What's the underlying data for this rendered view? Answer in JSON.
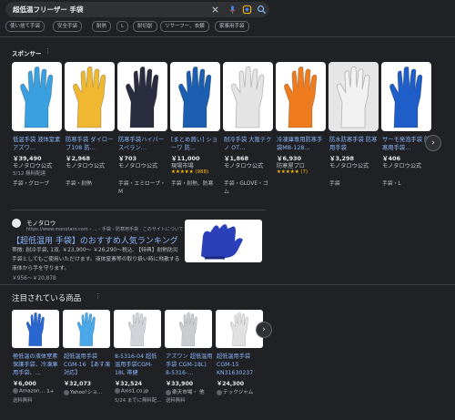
{
  "search": {
    "query": "超低温フリーザー 手袋",
    "icons": [
      "clear-icon",
      "mic-icon",
      "lens-icon",
      "search-icon"
    ]
  },
  "chips": [
    "使い捨て手袋",
    "安全手袋",
    "耐熱",
    "L",
    "耐切創",
    "リサーフー、衣類",
    "家事用手袋"
  ],
  "sponsored": {
    "label": "スポンサー",
    "products": [
      {
        "title": "低温手袋 液体窒素 アズワ…",
        "price": "￥39,490",
        "shop": "モノタロウ公式",
        "extra": "5/12 無料配達",
        "category": "手袋・グローブ",
        "glove": "#3aa0e0",
        "bg": "#ffffff"
      },
      {
        "title": "防寒手袋 ダイローブ108 防…",
        "price": "￥2,968",
        "shop": "モノタロウ公式",
        "extra": "",
        "category": "手袋・耐熱",
        "glove": "#f0b830",
        "bg": "#ffffff"
      },
      {
        "title": "防寒手袋ハイパースペラン…",
        "price": "￥703",
        "shop": "モノタロウ公式",
        "extra": "",
        "category": "手袋・エミロープ・M",
        "glove": "#2a2d40",
        "bg": "#ffffff"
      },
      {
        "title": "[まとめ買い] ショーワ 防…",
        "price": "￥11,000",
        "shop": "現場市場",
        "extra": "★★★★★ (988)",
        "category": "手袋・耐熱、防寒",
        "glove": "#1c5fb0",
        "bg": "#ffffff"
      },
      {
        "title": "耐冷手袋 大阪テクノ OT…",
        "price": "￥1,868",
        "shop": "モノタロウ公式",
        "extra": "",
        "category": "手袋・GLOVE・ゴム",
        "glove": "#e4e4e4",
        "bg": "#ffffff"
      },
      {
        "title": "冷凍庫専用防寒手袋MB-128…",
        "price": "￥6,930",
        "shop": "防寒屋プロ",
        "extra": "★★★★★ (7)",
        "category": "",
        "glove": "#ee7c1e",
        "bg": "#ffffff"
      },
      {
        "title": "防水防寒手袋 防寒用手袋",
        "price": "￥3,298",
        "shop": "モノタロウ公式",
        "extra": "",
        "category": "手袋",
        "glove": "#f2f2f2",
        "bg": "#e6e6e6"
      },
      {
        "title": "サーモ発泡手袋 防寒用手袋…",
        "price": "￥406",
        "shop": "モノタロウ公式",
        "extra": "",
        "category": "手袋・L",
        "glove": "#1f5ec8",
        "bg": "#ffffff"
      }
    ]
  },
  "result": {
    "site_name": "モノタロウ",
    "site_url": "https://www.monotaro.com › ... › 手袋 › 防寒用手袋 · このサイトについて",
    "title": "【超低温用 手袋】のおすすめ人気ランキング",
    "snippet": "帯徴: 耐冷手袋, 1双. ￥23,900〜 ￥26,290〜税込. 【特典】耐熱防災手袋としてもご使用いただけます。液体窒素等の取り扱い時に飛散する液体から手を守ります。",
    "price_range": "￥956〜￥20,878"
  },
  "popular": {
    "title": "注目されている商品",
    "products": [
      {
        "title": "極低温の液体窒素保護手袋、冷凍庫用手袋、…",
        "price": "￥6,000",
        "shop": "Amazon…",
        "shop_suffix": "1+",
        "ship": "送料無料",
        "glove": "#2a66d0"
      },
      {
        "title": "超低温用手袋CGM-16 【あす楽対応】",
        "price": "￥32,073",
        "shop": "Yahoo!ショ…",
        "shop_suffix": "",
        "ship": "",
        "glove": "#4aa8e8"
      },
      {
        "title": "8-5316-04 超低温用手袋CGM-18L 帯健",
        "price": "￥32,524",
        "shop": "Axis1.co.jp",
        "shop_suffix": "",
        "ship": "5/24 までに無料配…",
        "glove": "#d0d4d8"
      },
      {
        "title": "アズワン 超低温用手袋 CGM-18L) 8-5316-…",
        "price": "￥33,900",
        "shop": "楽天市場・",
        "shop_suffix": "他",
        "ship": "送料無料",
        "glove": "#c8ccd0"
      },
      {
        "title": "超低温用手袋 CGM-15 KN31630237",
        "price": "￥24,300",
        "shop": "テックジャム",
        "shop_suffix": "",
        "ship": "",
        "glove": "#e0e0e0"
      }
    ]
  },
  "colors": {
    "background": "#202124",
    "link": "#8ab4f8",
    "text": "#e8eaed",
    "muted": "#9aa0a6"
  }
}
